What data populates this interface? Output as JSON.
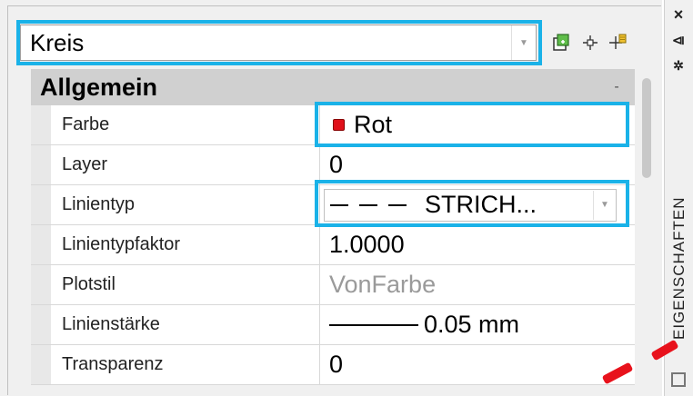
{
  "object_type": {
    "value": "Kreis"
  },
  "toolbar": {
    "icons": [
      "select-object-icon",
      "quick-select-icon",
      "pickadd-toggle-icon"
    ]
  },
  "section": {
    "title": "Allgemein",
    "collapse_glyph": "-"
  },
  "properties": [
    {
      "label": "Farbe",
      "value": "Rot",
      "color": "#e0101a"
    },
    {
      "label": "Layer",
      "value": "0"
    },
    {
      "label": "Linientyp",
      "value": "STRICH..."
    },
    {
      "label": "Linientypfaktor",
      "value": "1.0000"
    },
    {
      "label": "Plotstil",
      "value": "VonFarbe"
    },
    {
      "label": "Linienstärke",
      "value": "0.05 mm"
    },
    {
      "label": "Transparenz",
      "value": "0"
    }
  ],
  "sidebar": {
    "close_glyph": "×",
    "autohide_glyph": "⧏",
    "settings_glyph": "✲",
    "title": "EIGENSCHAFTEN"
  },
  "highlight_color": "#1ab2e8"
}
